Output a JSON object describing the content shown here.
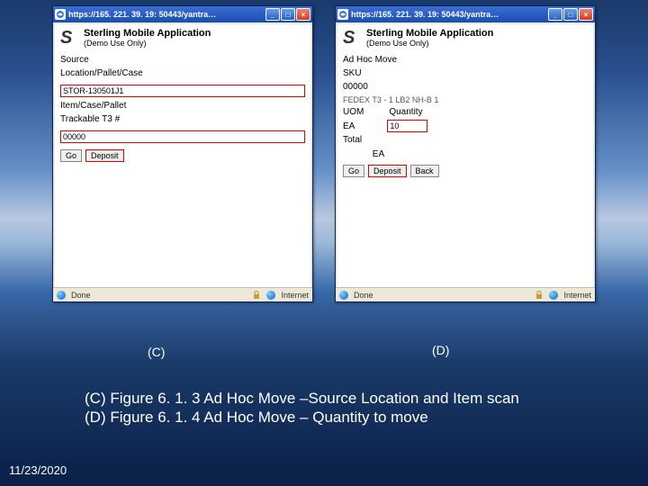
{
  "titlebar_url": "https://165. 221. 39. 19: 50443/yantra…",
  "app": {
    "title": "Sterling Mobile Application",
    "subtitle": "(Demo Use Only)"
  },
  "left_panel": {
    "label_source": "Source",
    "label_loc": "Location/Pallet/Case",
    "input_loc": "STOR-130501J1",
    "label_item": "Item/Case/Pallet",
    "label_track": "Trackable T3 #",
    "input_item": "00000",
    "btn_go": "Go",
    "btn_deposit": "Deposit"
  },
  "right_panel": {
    "title": "Ad Hoc Move",
    "label_sku": "SKU",
    "sku_val": "00000",
    "label_desc": "FEDEX T3 - 1 LB2 NH-B 1",
    "label_uom": "UOM",
    "label_qty": "Quantity",
    "uom_val": "EA",
    "qty_val": "10",
    "label_total": "Total",
    "total_ea": "EA",
    "btn_go": "Go",
    "btn_deposit": "Deposit",
    "btn_back": "Back"
  },
  "status": {
    "done": "Done",
    "internet": "Internet"
  },
  "labels": {
    "C": "(C)",
    "D": "(D)"
  },
  "caption": {
    "line1": "(C) Figure 6. 1. 3 Ad Hoc Move –Source Location and Item scan",
    "line2": "(D) Figure 6. 1. 4 Ad Hoc Move – Quantity to move"
  },
  "date": "11/23/2020"
}
